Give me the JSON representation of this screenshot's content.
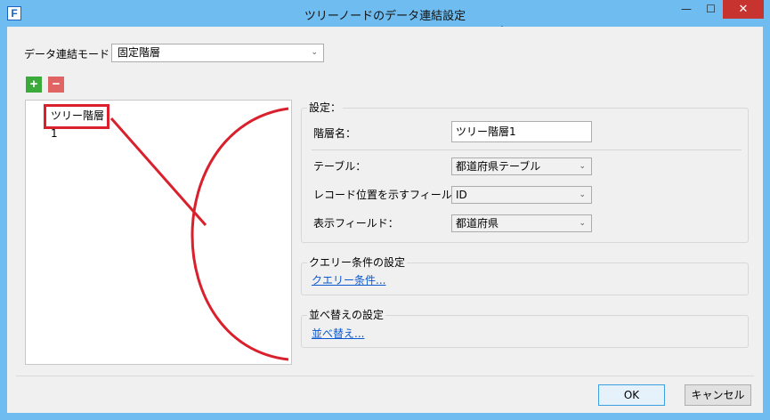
{
  "window": {
    "title": "ツリーノードのデータ連結設定",
    "app_icon": "F",
    "minimize": "—",
    "maximize": "☐",
    "close": "✕"
  },
  "mode": {
    "label": "データ連結モード：",
    "value": "固定階層"
  },
  "toolbar": {
    "add": "+",
    "remove": "−"
  },
  "tree": {
    "items": [
      {
        "label": "ツリー階層1"
      }
    ]
  },
  "settings": {
    "title": "設定：",
    "layer_name": {
      "label": "階層名：",
      "value": "ツリー階層1"
    },
    "table": {
      "label": "テーブル：",
      "value": "都道府県テーブル"
    },
    "record_field": {
      "label": "レコード位置を示すフィールド：",
      "value": "ID"
    },
    "display_field": {
      "label": "表示フィールド：",
      "value": "都道府県"
    }
  },
  "query": {
    "title": "クエリー条件の設定",
    "link": "クエリー条件..."
  },
  "sort": {
    "title": "並べ替えの設定",
    "link": "並べ替え..."
  },
  "buttons": {
    "ok": "OK",
    "cancel": "キャンセル"
  },
  "colors": {
    "titlebar": "#6fbdf0",
    "close_button": "#c7342f",
    "annotation": "#d9202c",
    "link": "#0b58d0",
    "add_button": "#3aaa3a",
    "remove_button": "#e06464"
  }
}
